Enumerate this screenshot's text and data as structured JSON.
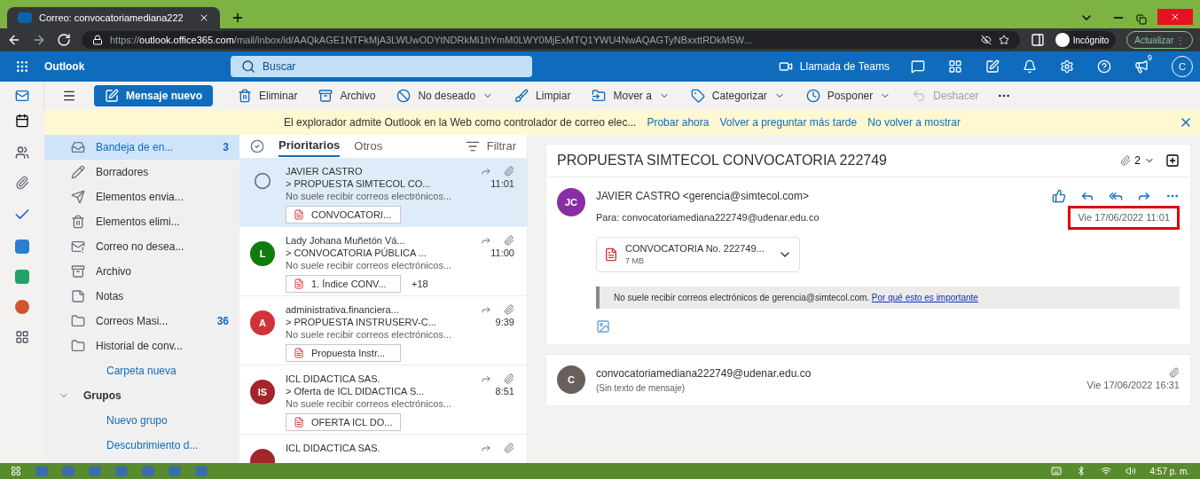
{
  "browser": {
    "tab_title": "Correo: convocatoriamediana222",
    "url_scheme": "https://",
    "url_host": "outlook.office365.com",
    "url_path": "/mail/inbox/id/AAQkAGE1NTFkMjA3LWUwODYtNDRkMi1hYmM0LWY0MjExMTQ1YWU4NwAQAGTyNBxxttRDkM5W...",
    "incognito": "Incógnito",
    "update": "Actualizar",
    "update_menu": "⋮"
  },
  "header": {
    "app_name": "Outlook",
    "search_placeholder": "Buscar",
    "teams": "Llamada de Teams",
    "badge": "9",
    "avatar": "C"
  },
  "toolbar": {
    "new_message": "Mensaje nuevo",
    "actions": [
      {
        "label": "Eliminar",
        "dropdown": false,
        "disabled": false
      },
      {
        "label": "Archivo",
        "dropdown": false,
        "disabled": false
      },
      {
        "label": "No deseado",
        "dropdown": true,
        "disabled": false
      },
      {
        "label": "Limpiar",
        "dropdown": false,
        "disabled": false
      },
      {
        "label": "Mover a",
        "dropdown": true,
        "disabled": false
      },
      {
        "label": "Categorizar",
        "dropdown": true,
        "disabled": false
      },
      {
        "label": "Posponer",
        "dropdown": true,
        "disabled": false
      },
      {
        "label": "Deshacer",
        "dropdown": false,
        "disabled": true
      }
    ]
  },
  "banner": {
    "message": "El explorador admite Outlook en la Web como controlador de correo elec...",
    "links": [
      "Probar ahora",
      "Volver a preguntar más tarde",
      "No volver a mostrar"
    ]
  },
  "folders": {
    "items": [
      {
        "label": "Bandeja de en...",
        "count": "3",
        "selected": true
      },
      {
        "label": "Borradores",
        "selected": false
      },
      {
        "label": "Elementos envia...",
        "selected": false
      },
      {
        "label": "Elementos elimi...",
        "selected": false
      },
      {
        "label": "Correo no desea...",
        "selected": false
      },
      {
        "label": "Archivo",
        "selected": false
      },
      {
        "label": "Notas",
        "selected": false
      },
      {
        "label": "Correos Masi...",
        "count": "36",
        "selected": false
      },
      {
        "label": "Historial de conv...",
        "selected": false
      }
    ],
    "new_folder": "Carpeta nueva",
    "groups": {
      "label": "Grupos",
      "expanded": true,
      "links": [
        "Nuevo grupo",
        "Descubrimiento d..."
      ]
    }
  },
  "message_list": {
    "tabs": [
      {
        "label": "Prioritarios",
        "selected": true
      },
      {
        "label": "Otros",
        "selected": false
      }
    ],
    "filter": "Filtrar",
    "messages": [
      {
        "sender": "JAVIER CASTRO",
        "subject": "> PROPUESTA SIMTECOL CO...",
        "time": "11:01",
        "preview": "No suele recibir correos electrónicos...",
        "attachment": "CONVOCATORI...",
        "selected": true
      },
      {
        "avatar": "L",
        "color": "#107c10",
        "sender": "Lady Johana Muñetón Vá...",
        "subject": "> CONVOCATORIA PÚBLICA ...",
        "time": "11:00",
        "preview": "No suele recibir correos electrónicos...",
        "attachment": "1. Índice CONV...",
        "extra": "+18",
        "selected": false
      },
      {
        "avatar": "A",
        "color": "#d13438",
        "sender": "administrativa.financiera...",
        "subject": "> PROPUESTA INSTRUSERV-C...",
        "time": "9:39",
        "preview": "No suele recibir correos electrónicos...",
        "attachment": "Propuesta Instr...",
        "selected": false
      },
      {
        "avatar": "IS",
        "color": "#a4262c",
        "sender": "ICL DIDACTICA SAS.",
        "subject": "> Oferta de ICL DIDACTICA S...",
        "time": "8:51",
        "preview": "No suele recibir correos electrónicos...",
        "attachment": "OFERTA ICL DO...",
        "selected": false
      },
      {
        "color": "#a4262c",
        "sender": "ICL DIDACTICA SAS.",
        "selected": false
      }
    ]
  },
  "reading": {
    "subject": "PROPUESTA SIMTECOL CONVOCATORIA 222749",
    "attachment_count": "2",
    "messages": [
      {
        "kind": "expanded",
        "avatar": "JC",
        "color": "#8a2da5",
        "from": "JAVIER CASTRO <gerencia@simtecol.com>",
        "to_label": "Para:",
        "to": "convocatoriamediana222749@udenar.edu.co",
        "date": "Vie 17/06/2022 11:01",
        "highlighted": true,
        "attachment": {
          "name": "CONVOCATORIA No. 222749...",
          "size": "7 MB"
        },
        "notice": "No suele recibir correos electrónicos de gerencia@simtecol.com.",
        "notice_link": "Por qué esto es importante"
      },
      {
        "kind": "collapsed",
        "avatar": "C",
        "color": "#69605c",
        "from": "convocatoriamediana222749@udenar.edu.co",
        "preview": "(Sin texto de mensaje)",
        "date": "Vie 17/06/2022 16:31"
      }
    ]
  },
  "taskbar": {
    "clock": "4:57 p. m."
  }
}
